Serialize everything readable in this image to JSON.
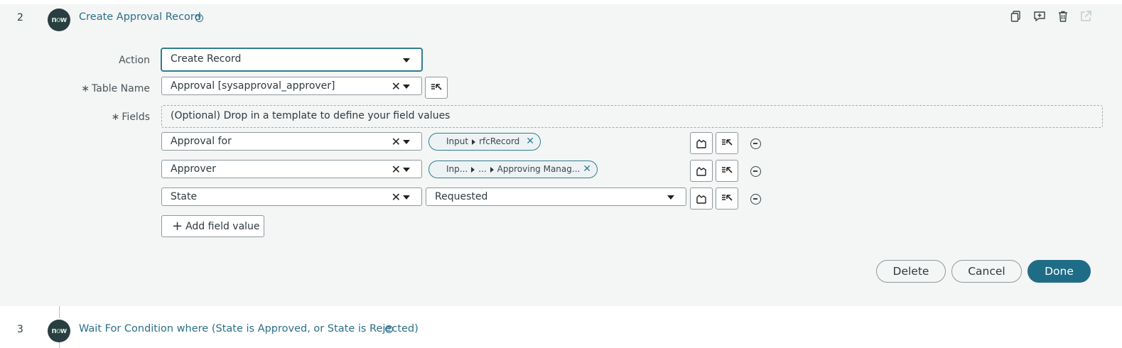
{
  "step2": {
    "number": "2",
    "logo": "now",
    "title": "Create Approval Record",
    "help_icon": "question-circle-icon",
    "toolbar_icons": [
      "copy-icon",
      "add-comment-icon",
      "trash-icon",
      "open-external-icon"
    ]
  },
  "form": {
    "action_label": "Action",
    "action_value": "Create Record",
    "table_label": "Table Name",
    "table_value": "Approval [sysapproval_approver]",
    "fields_label": "Fields",
    "required_marker": "∗",
    "dropzone_text": "(Optional) Drop in a template to define your field values",
    "rows": [
      {
        "field": "Approval for",
        "value_type": "pill",
        "pill_parts": [
          "Input",
          "rfcRecord"
        ]
      },
      {
        "field": "Approver",
        "value_type": "pill",
        "pill_parts": [
          "Inp...",
          "...",
          "Approving Manag..."
        ]
      },
      {
        "field": "State",
        "value_type": "select",
        "select_value": "Requested"
      }
    ],
    "add_field_label": "Add field value"
  },
  "buttons": {
    "delete": "Delete",
    "cancel": "Cancel",
    "done": "Done"
  },
  "step3": {
    "number": "3",
    "logo": "now",
    "title": "Wait For Condition where (State is Approved, or State is Rejected)",
    "help_icon": "question-circle-icon"
  },
  "colors": {
    "accent": "#2c6f87",
    "primary_button": "#1f6c86",
    "panel_bg": "#f4f5f5",
    "logo_bg": "#293e40"
  }
}
